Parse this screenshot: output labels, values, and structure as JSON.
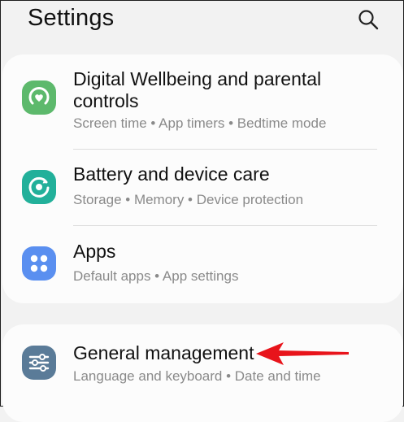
{
  "header": {
    "title": "Settings"
  },
  "items": [
    {
      "title_line1": "Digital Wellbeing and parental",
      "title_line2": "controls",
      "subtitle": "Screen time  •  App timers  •  Bedtime mode",
      "icon": "digital-wellbeing-icon",
      "color": "#5db96c"
    },
    {
      "title": "Battery and device care",
      "subtitle": "Storage  •  Memory  •  Device protection",
      "icon": "device-care-icon",
      "color": "#22b09a"
    },
    {
      "title": "Apps",
      "subtitle": "Default apps  •  App settings",
      "icon": "apps-icon",
      "color": "#5a8ff0"
    },
    {
      "title": "General management",
      "subtitle": "Language and keyboard  •  Date and time",
      "icon": "general-management-icon",
      "color": "#5a7b98"
    }
  ],
  "colors": {
    "annotation_arrow": "#e8141b",
    "background": "#f2f2f2",
    "card": "#fcfcfc"
  }
}
